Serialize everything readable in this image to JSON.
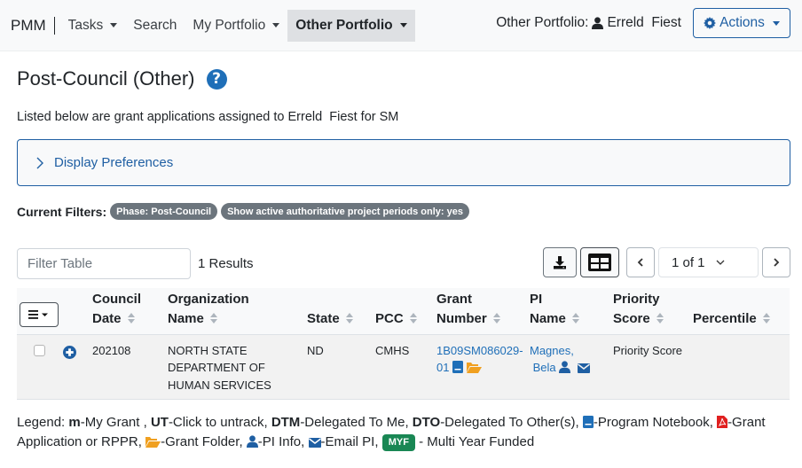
{
  "nav": {
    "brand": "PMM",
    "items": [
      {
        "label": "Tasks",
        "has_caret": true
      },
      {
        "label": "Search",
        "has_caret": false
      },
      {
        "label": "My Portfolio",
        "has_caret": true
      },
      {
        "label": "Other Portfolio",
        "has_caret": true,
        "active": true
      }
    ],
    "portfolio_prefix": "Other Portfolio:",
    "portfolio_user": "Erreld  Fiest",
    "actions_label": "Actions"
  },
  "page": {
    "title": "Post-Council (Other)",
    "help_glyph": "?",
    "subtitle": "Listed below are grant applications assigned to Erreld  Fiest for SM",
    "display_prefs_label": "Display Preferences",
    "filters_label": "Current Filters:",
    "filters": [
      "Phase: Post-Council",
      "Show active authoritative project periods only: yes"
    ]
  },
  "toolbar": {
    "filter_placeholder": "Filter Table",
    "filter_value": "",
    "results": "1 Results",
    "page_select": "1 of 1"
  },
  "table": {
    "headers": [
      {
        "line1": "Council",
        "line2": "Date"
      },
      {
        "line1": "Organization",
        "line2": "Name"
      },
      {
        "line1": "",
        "line2": "State"
      },
      {
        "line1": "",
        "line2": "PCC"
      },
      {
        "line1": "Grant",
        "line2": "Number"
      },
      {
        "line1": "PI",
        "line2": "Name"
      },
      {
        "line1": "Priority",
        "line2": "Score"
      },
      {
        "line1": "",
        "line2": "Percentile"
      }
    ],
    "rows": [
      {
        "checked": false,
        "council_date": "202108",
        "org_line1": "NORTH STATE",
        "org_line2": "DEPARTMENT OF",
        "org_line3": "HUMAN SERVICES",
        "state": "ND",
        "pcc": "CMHS",
        "grant_line1": "1B09SM086029-",
        "grant_line2": "01",
        "pi_line1": "Magnes,",
        "pi_line2": "Bela",
        "priority_score": "Priority Score",
        "percentile": ""
      }
    ]
  },
  "legend": {
    "prefix": "Legend:",
    "m_code": "m",
    "m_text": "-My Grant ,",
    "ut_code": "UT",
    "ut_text": "-Click to untrack,",
    "dtm_code": "DTM",
    "dtm_text": "-Delegated To Me,",
    "dto_code": "DTO",
    "dto_text": "-Delegated To Other(s),",
    "notebook_text": "-Program Notebook,",
    "pdf_text": "-Grant Application or RPPR,",
    "folder_text": "-Grant Folder,",
    "pi_text": "-PI Info,",
    "email_text": "-Email PI,",
    "myf_badge": "MYF",
    "myf_text": "- Multi Year Funded"
  },
  "colors": {
    "primary": "#1f5fa3",
    "link": "#1f6fb8",
    "badge_gray": "#6c757d",
    "myf_green": "#198754",
    "folder_orange": "#f0a020",
    "pdf_red": "#e02020"
  }
}
